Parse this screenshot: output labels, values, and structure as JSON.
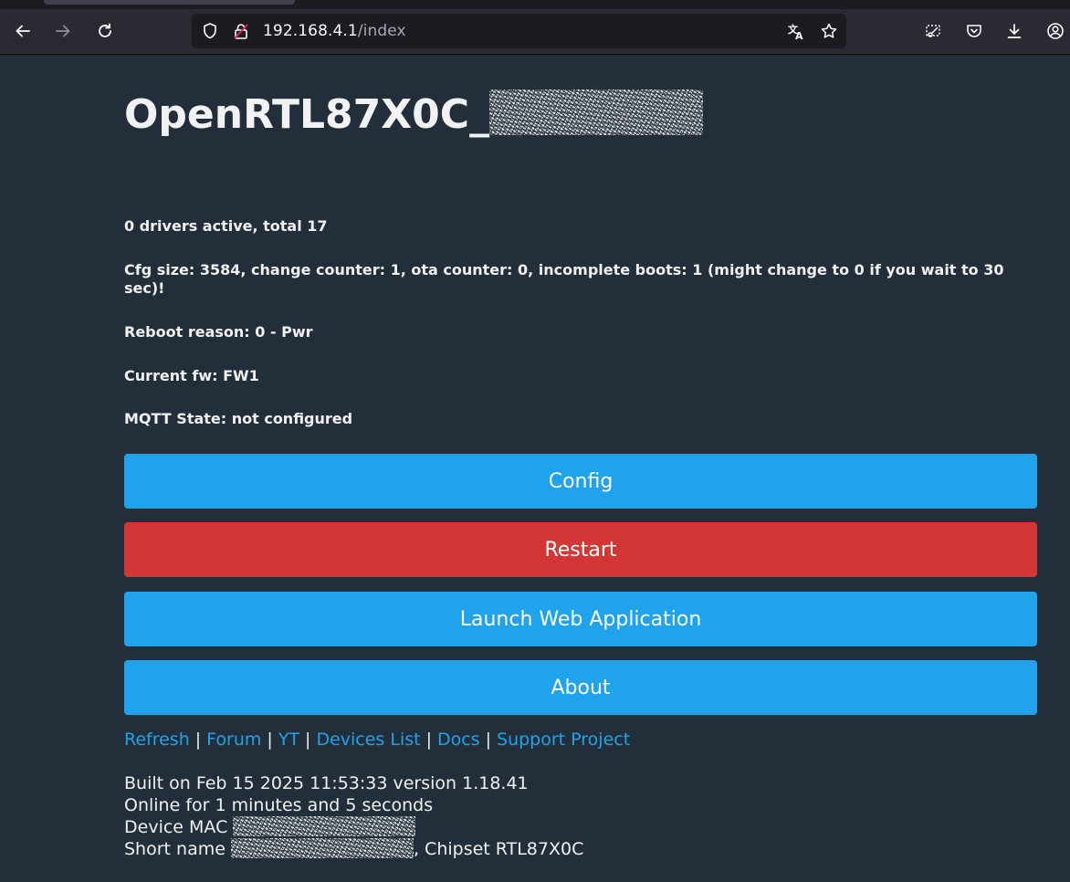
{
  "browser": {
    "url_host": "192.168.4.1",
    "url_path": "/index"
  },
  "page": {
    "title_prefix": "OpenRTL87X0C_",
    "info": [
      "0 drivers active, total 17",
      "Cfg size: 3584, change counter: 1, ota counter: 0, incomplete boots: 1 (might change to 0 if you wait to 30 sec)!",
      "Reboot reason: 0 - Pwr",
      "Current fw: FW1",
      "MQTT State: not configured"
    ],
    "buttons": {
      "config": "Config",
      "restart": "Restart",
      "launch": "Launch Web Application",
      "about": "About"
    },
    "links": {
      "refresh": "Refresh",
      "forum": "Forum",
      "yt": "YT",
      "devices": "Devices List",
      "docs": "Docs",
      "support": "Support Project",
      "separator": "|"
    },
    "footer": {
      "built": "Built on Feb 15 2025 11:53:33 version 1.18.41",
      "online": "Online for 1 minutes and 5 seconds",
      "mac_label": "Device MAC",
      "short_name_label": "Short name",
      "chipset": ", Chipset RTL87X0C"
    }
  },
  "colors": {
    "background": "#222f3a",
    "button_blue": "#1fa3ec",
    "button_red": "#d43535",
    "link": "#1fa3ec"
  }
}
